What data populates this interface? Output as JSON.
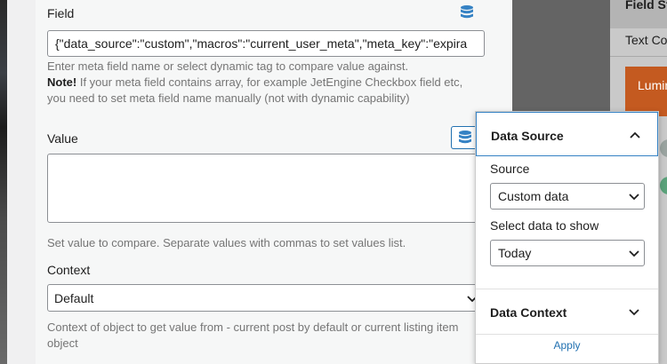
{
  "field": {
    "label": "Field",
    "value": "{\"data_source\":\"custom\",\"macros\":\"current_user_meta\",\"meta_key\":\"expira",
    "help_line1": "Enter meta field name or select dynamic tag to compare value against.",
    "note_bold": "Note!",
    "help_line2": " If your meta field contains array, for example JetEngine Checkbox field etc,",
    "help_line3": "you need to set meta field name manually (not with dynamic capability)"
  },
  "value_field": {
    "label": "Value",
    "value": "",
    "help": "Set value to compare. Separate values with commas to set values list."
  },
  "context": {
    "label": "Context",
    "selected": "Default",
    "help_line1": "Context of object to get value from - current post by default or current listing item",
    "help_line2": "object"
  },
  "popover": {
    "section_title": "Data Source",
    "source_label": "Source",
    "source_selected": "Custom data",
    "show_label": "Select data to show",
    "show_selected": "Today",
    "context_title": "Data Context",
    "apply_label": "Apply"
  },
  "right_panel": {
    "header": "Field St",
    "subheader": "Text Co",
    "button_text": "Lumin"
  },
  "colors": {
    "accent": "#2271b1",
    "database_icon": "#3582c4",
    "orange_button": "#c45a20"
  }
}
